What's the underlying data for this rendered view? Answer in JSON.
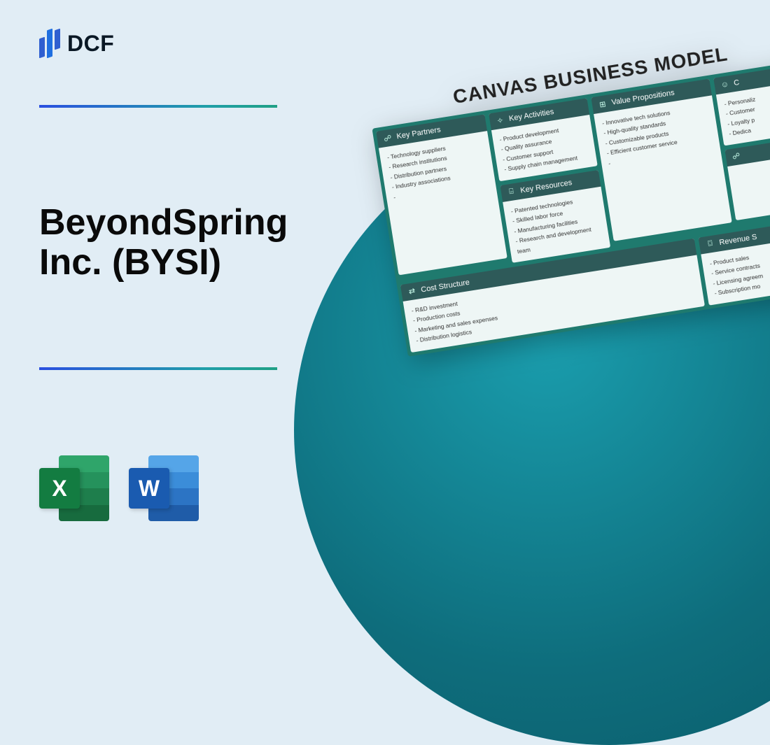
{
  "logo_text": "DCF",
  "title": "BeyondSpring Inc. (BYSI)",
  "file_icons": {
    "excel": "X",
    "word": "W"
  },
  "canvas": {
    "title": "CANVAS BUSINESS MODEL",
    "key_partners": {
      "label": "Key Partners",
      "items": [
        "Technology suppliers",
        "Research institutions",
        "Distribution partners",
        "Industry associations"
      ]
    },
    "key_activities": {
      "label": "Key Activities",
      "items": [
        "Product development",
        "Quality assurance",
        "Customer support",
        "Supply chain management"
      ]
    },
    "key_resources": {
      "label": "Key Resources",
      "items": [
        "Patented technologies",
        "Skilled labor force",
        "Manufacturing facilities",
        "Research and development team"
      ]
    },
    "value_propositions": {
      "label": "Value Propositions",
      "items": [
        "Innovative tech solutions",
        "High-quality standards",
        "Customizable products",
        "Efficient customer service"
      ]
    },
    "customer_relationships": {
      "label": "C",
      "items": [
        "Personaliz",
        "Customer",
        "Loyalty p",
        "Dedica"
      ]
    },
    "cost_structure": {
      "label": "Cost Structure",
      "items": [
        "R&D investment",
        "Production costs",
        "Marketing and sales expenses",
        "Distribution logistics"
      ]
    },
    "revenue_streams": {
      "label": "Revenue S",
      "items": [
        "Product sales",
        "Service contracts",
        "Licensing agreem",
        "Subscription mo"
      ]
    }
  }
}
